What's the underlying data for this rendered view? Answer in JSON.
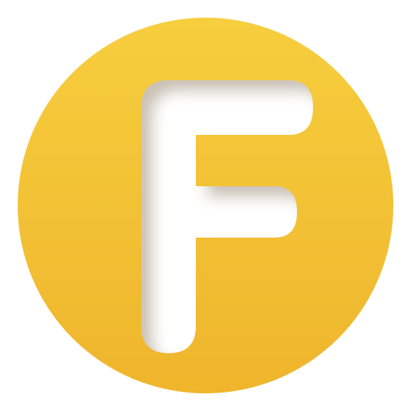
{
  "icon": {
    "name": "letter-f-app-icon",
    "letter": "F",
    "colors": {
      "circle_top": "#F6CE3E",
      "circle_bottom": "#EFB52C",
      "letter_fill": "#FFFFFF",
      "inner_shadow": "#8A6A20",
      "background": "#FFFFFF"
    }
  }
}
